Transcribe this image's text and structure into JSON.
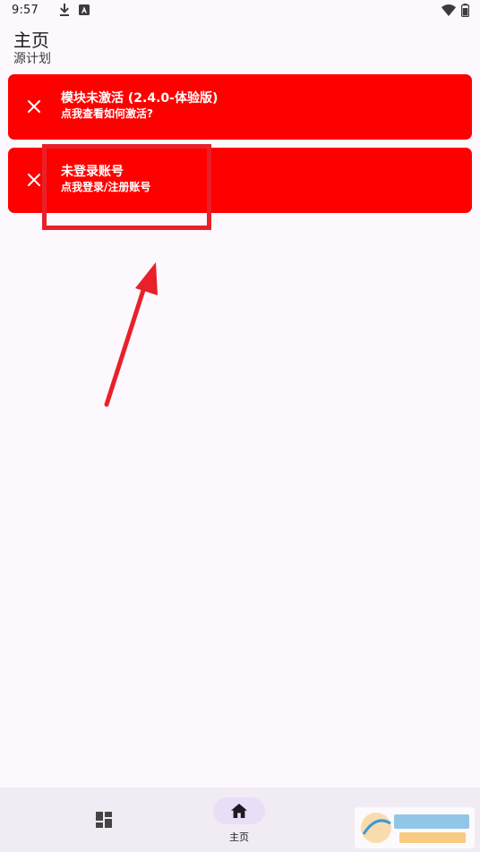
{
  "status_bar": {
    "time": "9:57"
  },
  "app": {
    "title": "主页",
    "subtitle": "源计划"
  },
  "banners": [
    {
      "title": "模块未激活 (2.4.0-体验版)",
      "subtitle": "点我查看如何激活?"
    },
    {
      "title": "未登录账号",
      "subtitle": "点我登录/注册账号"
    }
  ],
  "nav": {
    "home_label": "主页"
  },
  "colors": {
    "banner": "#ff0000",
    "annotation": "#e8202a",
    "nav_background": "#f1ecf4",
    "nav_active_pill": "#e8def8",
    "page_background": "#fdf8fd"
  },
  "icons": {
    "banner_close": "close-icon",
    "nav_dashboard": "dashboard-icon",
    "nav_home": "home-icon",
    "status": [
      "download-icon",
      "notification-a-icon",
      "wifi-icon",
      "battery-icon"
    ]
  }
}
